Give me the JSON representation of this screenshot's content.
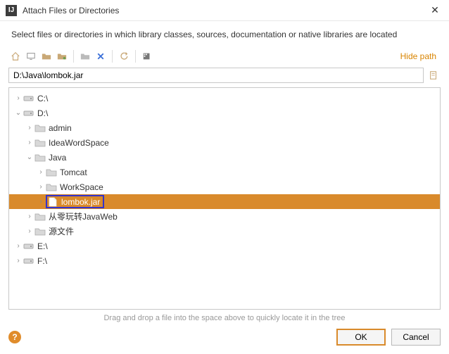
{
  "titlebar": {
    "icon_text": "IJ",
    "title": "Attach Files or Directories"
  },
  "subtitle": "Select files or directories in which library classes, sources, documentation or native libraries are located",
  "toolbar": {
    "hide_path": "Hide path"
  },
  "path_input": {
    "value": "D:\\Java\\lombok.jar"
  },
  "tree": {
    "items": [
      {
        "label": "C:\\",
        "type": "drive",
        "indent": 1,
        "arrow": "right"
      },
      {
        "label": "D:\\",
        "type": "drive",
        "indent": 1,
        "arrow": "down"
      },
      {
        "label": "admin",
        "type": "folder",
        "indent": 2,
        "arrow": "right"
      },
      {
        "label": "IdeaWordSpace",
        "type": "folder",
        "indent": 2,
        "arrow": "right"
      },
      {
        "label": "Java",
        "type": "folder",
        "indent": 2,
        "arrow": "down"
      },
      {
        "label": "Tomcat",
        "type": "folder",
        "indent": 3,
        "arrow": "right"
      },
      {
        "label": "WorkSpace",
        "type": "folder",
        "indent": 3,
        "arrow": "right"
      },
      {
        "label": "lombok.jar",
        "type": "file",
        "indent": 3,
        "arrow": "right",
        "selected": true,
        "boxed": true
      },
      {
        "label": "从零玩转JavaWeb",
        "type": "folder",
        "indent": 2,
        "arrow": "right"
      },
      {
        "label": "源文件",
        "type": "folder",
        "indent": 2,
        "arrow": "right"
      },
      {
        "label": "E:\\",
        "type": "drive",
        "indent": 1,
        "arrow": "right"
      },
      {
        "label": "F:\\",
        "type": "drive",
        "indent": 1,
        "arrow": "right"
      }
    ]
  },
  "hint": "Drag and drop a file into the space above to quickly locate it in the tree",
  "footer": {
    "ok": "OK",
    "cancel": "Cancel"
  }
}
